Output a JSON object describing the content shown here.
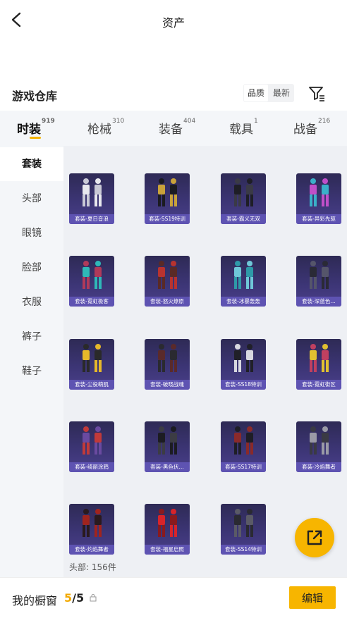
{
  "header": {
    "title": "资产"
  },
  "section": {
    "title": "游戏仓库",
    "sort": [
      "品质",
      "最新"
    ]
  },
  "tabs": [
    {
      "label": "时装",
      "count": "919"
    },
    {
      "label": "枪械",
      "count": "310"
    },
    {
      "label": "装备",
      "count": "404"
    },
    {
      "label": "载具",
      "count": "1"
    },
    {
      "label": "战备",
      "count": "216"
    }
  ],
  "sidebar": {
    "items": [
      "套装",
      "头部",
      "眼镜",
      "脸部",
      "衣服",
      "裤子",
      "鞋子"
    ]
  },
  "items": [
    {
      "label": "套装-夏日音浪",
      "icon": "outfit-white-hooded-icon"
    },
    {
      "label": "套装-SS19特训",
      "icon": "outfit-gold-black-icon"
    },
    {
      "label": "套装-霸义无双",
      "icon": "outfit-black-icon"
    },
    {
      "label": "套装-异彩先驱",
      "icon": "outfit-colorful-icon"
    },
    {
      "label": "套装-霓虹极客",
      "icon": "outfit-neon-geek-icon"
    },
    {
      "label": "套装-怒火燎原",
      "icon": "outfit-red-jacket-icon"
    },
    {
      "label": "套装-冰暴轰轰",
      "icon": "outfit-ice-icon"
    },
    {
      "label": "套装-深蓝色…",
      "icon": "outfit-dark-blue-icon"
    },
    {
      "label": "套装-尘役萌肌",
      "icon": "outfit-yellow-icon"
    },
    {
      "label": "套装-破晓战魂",
      "icon": "outfit-hooded-cloak-icon"
    },
    {
      "label": "套装-SS18特训",
      "icon": "outfit-black-white-icon"
    },
    {
      "label": "套装-霓虹街区",
      "icon": "outfit-street-icon"
    },
    {
      "label": "套装-绮丽涂鸦",
      "icon": "outfit-graffiti-icon"
    },
    {
      "label": "套装-黑色伏…",
      "icon": "outfit-black-shadow-icon"
    },
    {
      "label": "套装-SS17特训",
      "icon": "outfit-red-black-icon"
    },
    {
      "label": "套装-冷焰舞者",
      "icon": "outfit-grey-dancer-icon"
    },
    {
      "label": "套装-灼焰舞者",
      "icon": "outfit-red-dancer-icon"
    },
    {
      "label": "套装-福星启照",
      "icon": "outfit-red-festive-icon"
    },
    {
      "label": "套装-SS14特训",
      "icon": "outfit-dark-armor-icon"
    }
  ],
  "summary": "头部: 156件",
  "bottom": {
    "label": "我的橱窗",
    "current": "5",
    "total": "/5",
    "edit": "编辑"
  },
  "colors": {
    "accent": "#f7b500",
    "card_bg": "#3c3575",
    "label_bg": "#6054b4"
  }
}
